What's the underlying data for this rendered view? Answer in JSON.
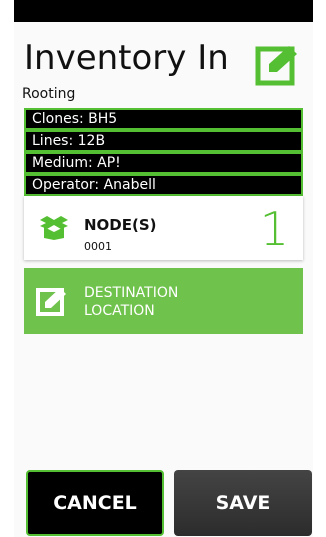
{
  "header": {
    "title": "Inventory In",
    "subtitle": "Rooting"
  },
  "info": [
    {
      "label": "Clones: BH5"
    },
    {
      "label": "Lines: 12B"
    },
    {
      "label": "Medium: AP!"
    },
    {
      "label": "Operator: Anabell"
    }
  ],
  "node": {
    "label": "NODE(S)",
    "id": "0001",
    "count": "1"
  },
  "destination": {
    "label": "DESTINATION LOCATION"
  },
  "buttons": {
    "cancel": "CANCEL",
    "save": "SAVE"
  },
  "colors": {
    "accent": "#55bf33",
    "card_green": "#6fc24c"
  }
}
